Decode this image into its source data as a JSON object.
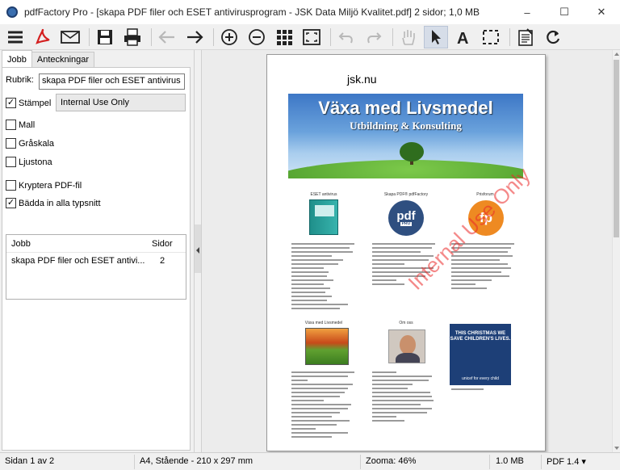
{
  "window": {
    "title": "pdfFactory Pro - [skapa PDF filer och ESET antivirusprogram - JSK Data Miljö Kvalitet.pdf] 2 sidor; 1,0 MB",
    "controls": {
      "minimize": "–",
      "maximize": "☐",
      "close": "✕"
    }
  },
  "toolbar": {
    "icons": [
      "menu-icon",
      "pdf-icon",
      "email-icon",
      "save-icon",
      "print-icon",
      "back-icon",
      "forward-icon",
      "zoom-in-icon",
      "zoom-out-icon",
      "thumbnails-icon",
      "fit-page-icon",
      "undo-icon",
      "redo-icon",
      "hand-icon",
      "select-arrow-icon",
      "text-tool-icon",
      "crop-icon",
      "notes-icon",
      "refresh-icon"
    ]
  },
  "left_panel": {
    "tabs": [
      {
        "label": "Jobb",
        "active": true
      },
      {
        "label": "Anteckningar",
        "active": false
      }
    ],
    "rubrik_label": "Rubrik:",
    "rubrik_value": "skapa PDF filer och ESET antivirus",
    "stampel_label": "Stämpel",
    "stampel_checked": true,
    "stampel_value": "Internal Use Only",
    "options": [
      {
        "label": "Mall",
        "checked": false
      },
      {
        "label": "Gråskala",
        "checked": false
      },
      {
        "label": "Ljustona",
        "checked": false
      },
      {
        "label": "Kryptera PDF-fil",
        "checked": false
      },
      {
        "label": "Bädda in alla typsnitt",
        "checked": true
      }
    ],
    "job_table": {
      "headers": [
        "Jobb",
        "Sidor"
      ],
      "rows": [
        {
          "name": "skapa PDF filer och ESET antivi...",
          "pages": "2"
        }
      ]
    }
  },
  "document": {
    "site": "jsk.nu",
    "banner_title": "Växa med Livsmedel",
    "banner_subtitle": "Utbildning & Konsulting",
    "col_heads": [
      "ESET antivirus",
      "Skapa PDF® pdfFactory",
      "Prisforum"
    ],
    "row2_heads": [
      "Växa med Livsmedel",
      "Om oss",
      ""
    ],
    "logo_pdf": "pdf",
    "logo_pdf_sub": "PRO",
    "logo_fp": "fp",
    "unicef_text": "THIS CHRISTMAS WE SAVE CHILDREN'S LIVES.",
    "unicef_foot": "unicef for every child",
    "stamp": "Internal Use Only"
  },
  "status": {
    "page": "Sidan 1 av 2",
    "paper": "A4, Stående - 210 x 297 mm",
    "zoom": "Zooma: 46%",
    "size": "1.0 MB",
    "pdf_version": "PDF 1.4 ▾"
  }
}
